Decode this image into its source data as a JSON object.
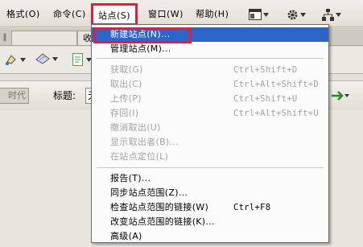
{
  "menubar": {
    "items": [
      {
        "label": "格式(O)"
      },
      {
        "label": "命令(C)"
      },
      {
        "label": "站点(S)"
      },
      {
        "label": "窗口(W)"
      },
      {
        "label": "帮助(H)"
      }
    ],
    "icons": [
      "layout-icon",
      "gear-icon",
      "site-tree-icon"
    ]
  },
  "tabs": {
    "items": [
      {
        "label": "收藏夹"
      }
    ]
  },
  "doc_toolbar": {
    "code_button_label": "时代码",
    "title_label": "标题:",
    "title_value": "无"
  },
  "site_menu": {
    "items": [
      {
        "label": "新建站点(N)...",
        "shortcut": "",
        "disabled": false
      },
      {
        "label": "管理站点(M)...",
        "shortcut": "",
        "disabled": false
      },
      {
        "label": "获取(G)",
        "shortcut": "Ctrl+Shift+D",
        "disabled": true
      },
      {
        "label": "取出(C)",
        "shortcut": "Ctrl+Alt+Shift+D",
        "disabled": true
      },
      {
        "label": "上传(P)",
        "shortcut": "Ctrl+Shift+U",
        "disabled": true
      },
      {
        "label": "存回(I)",
        "shortcut": "Ctrl+Alt+Shift+U",
        "disabled": true
      },
      {
        "label": "撤消取出(U)",
        "shortcut": "",
        "disabled": true
      },
      {
        "label": "显示取出者(B)...",
        "shortcut": "",
        "disabled": true
      },
      {
        "label": "在站点定位(L)",
        "shortcut": "",
        "disabled": true
      },
      {
        "label": "报告(T)...",
        "shortcut": "",
        "disabled": false
      },
      {
        "label": "同步站点范围(Z)...",
        "shortcut": "",
        "disabled": false
      },
      {
        "label": "检查站点范围的链接(W)",
        "shortcut": "Ctrl+F8",
        "disabled": false
      },
      {
        "label": "改变站点范围的链接(K)...",
        "shortcut": "",
        "disabled": false
      },
      {
        "label": "高级(A)",
        "shortcut": "",
        "disabled": false
      }
    ]
  },
  "colors": {
    "highlight_red": "#e0203a",
    "selection_blue": "#2e64c8",
    "disabled_text": "#a3a3a3"
  }
}
